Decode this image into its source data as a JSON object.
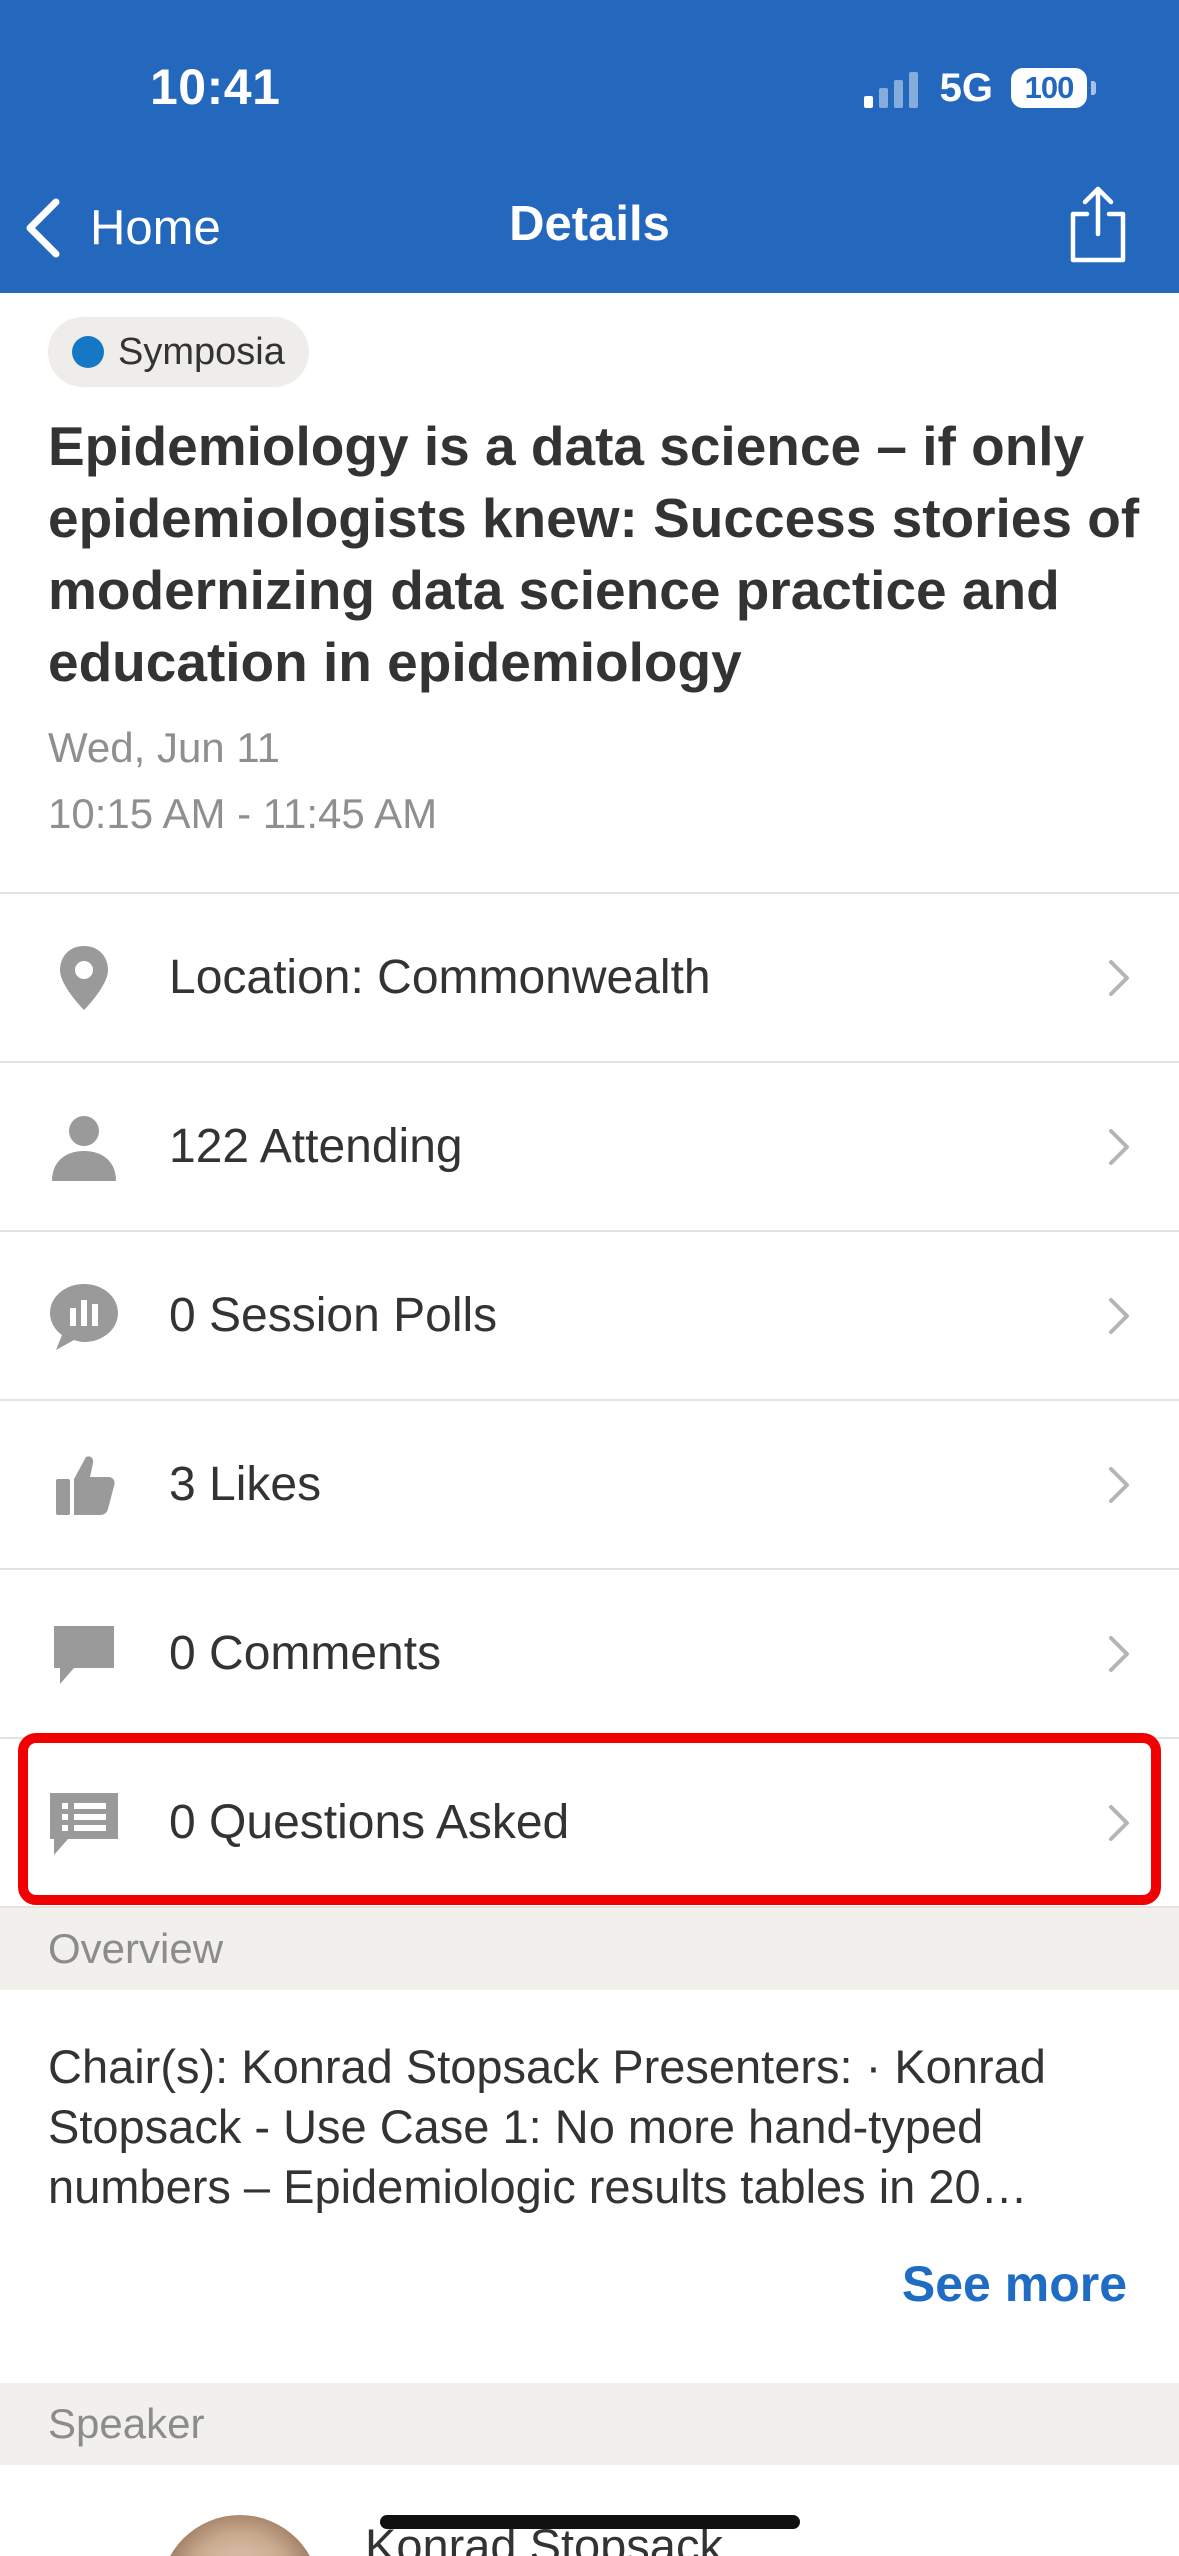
{
  "status_bar": {
    "time": "10:41",
    "network": "5G",
    "battery": "100"
  },
  "nav": {
    "back_label": "Home",
    "title": "Details"
  },
  "session": {
    "tag": "Symposia",
    "tag_color": "#1677c5",
    "title": "Epidemiology is a data science – if only epidemiologists knew: Success stories of modernizing data science practice and education in epidemiology",
    "date": "Wed, Jun 11",
    "time": "10:15 AM - 11:45 AM"
  },
  "rows": [
    {
      "label": "Location: Commonwealth",
      "icon": "location-pin-icon"
    },
    {
      "label": "122 Attending",
      "icon": "person-icon"
    },
    {
      "label": "0 Session Polls",
      "icon": "poll-bubble-icon"
    },
    {
      "label": "3 Likes",
      "icon": "thumbs-up-icon"
    },
    {
      "label": "0 Comments",
      "icon": "comment-icon"
    },
    {
      "label": "0 Questions Asked",
      "icon": "questions-icon"
    }
  ],
  "overview": {
    "header": "Overview",
    "text": "Chair(s): Konrad Stopsack Presenters: · Konrad Stopsack - Use Case 1: No more hand-typed numbers – Epidemiologic results tables in 20…",
    "see_more": "See more"
  },
  "speaker": {
    "header": "Speaker",
    "name": "Konrad Stopsack"
  },
  "colors": {
    "header_bg": "#2368bd",
    "accent": "#1f6cc4",
    "highlight": "#f00000"
  }
}
